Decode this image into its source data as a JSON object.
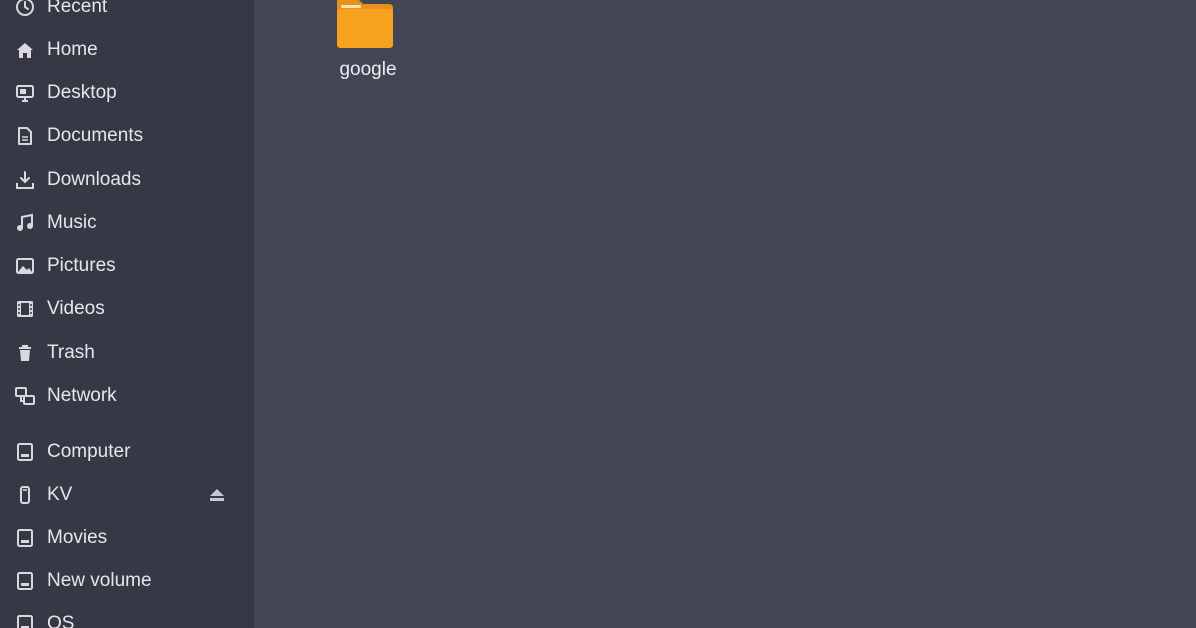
{
  "sidebar": {
    "items": [
      {
        "label": "Recent",
        "icon": "clock-icon"
      },
      {
        "label": "Home",
        "icon": "home-icon"
      },
      {
        "label": "Desktop",
        "icon": "desktop-icon"
      },
      {
        "label": "Documents",
        "icon": "document-icon"
      },
      {
        "label": "Downloads",
        "icon": "download-icon"
      },
      {
        "label": "Music",
        "icon": "music-icon"
      },
      {
        "label": "Pictures",
        "icon": "picture-icon"
      },
      {
        "label": "Videos",
        "icon": "video-icon"
      },
      {
        "label": "Trash",
        "icon": "trash-icon"
      },
      {
        "label": "Network",
        "icon": "network-icon"
      }
    ],
    "devices": [
      {
        "label": "Computer",
        "icon": "drive-icon"
      },
      {
        "label": "KV",
        "icon": "usb-drive-icon",
        "eject_icon": "eject-icon"
      },
      {
        "label": "Movies",
        "icon": "drive-icon"
      },
      {
        "label": "New volume",
        "icon": "drive-icon"
      },
      {
        "label": "OS",
        "icon": "drive-icon"
      }
    ]
  },
  "files": [
    {
      "name": "google",
      "icon": "folder-icon"
    }
  ],
  "colors": {
    "sidebar_bg": "#373845",
    "main_bg": "#444554",
    "text": "#e6e6ea",
    "folder": "#f6a21e"
  }
}
